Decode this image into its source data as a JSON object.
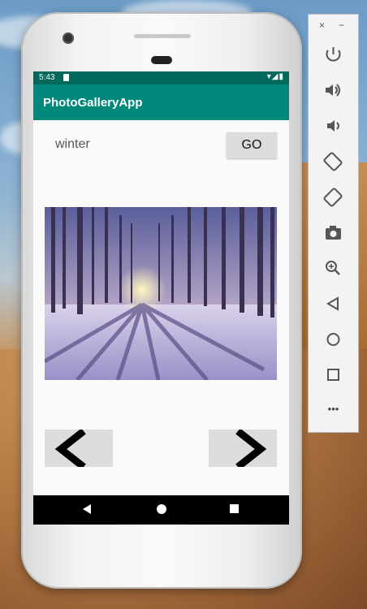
{
  "status": {
    "time": "5:43",
    "icons": "▾◢▮"
  },
  "app": {
    "title": "PhotoGalleryApp"
  },
  "search": {
    "value": "winter"
  },
  "buttons": {
    "go": "GO"
  },
  "emulator": {
    "close": "×",
    "minimize": "−",
    "tools": [
      "power-icon",
      "volume-up-icon",
      "volume-down-icon",
      "rotate-left-icon",
      "rotate-right-icon",
      "camera-icon",
      "zoom-icon",
      "back-icon",
      "home-icon",
      "overview-icon",
      "more-icon"
    ],
    "more": "•••"
  }
}
